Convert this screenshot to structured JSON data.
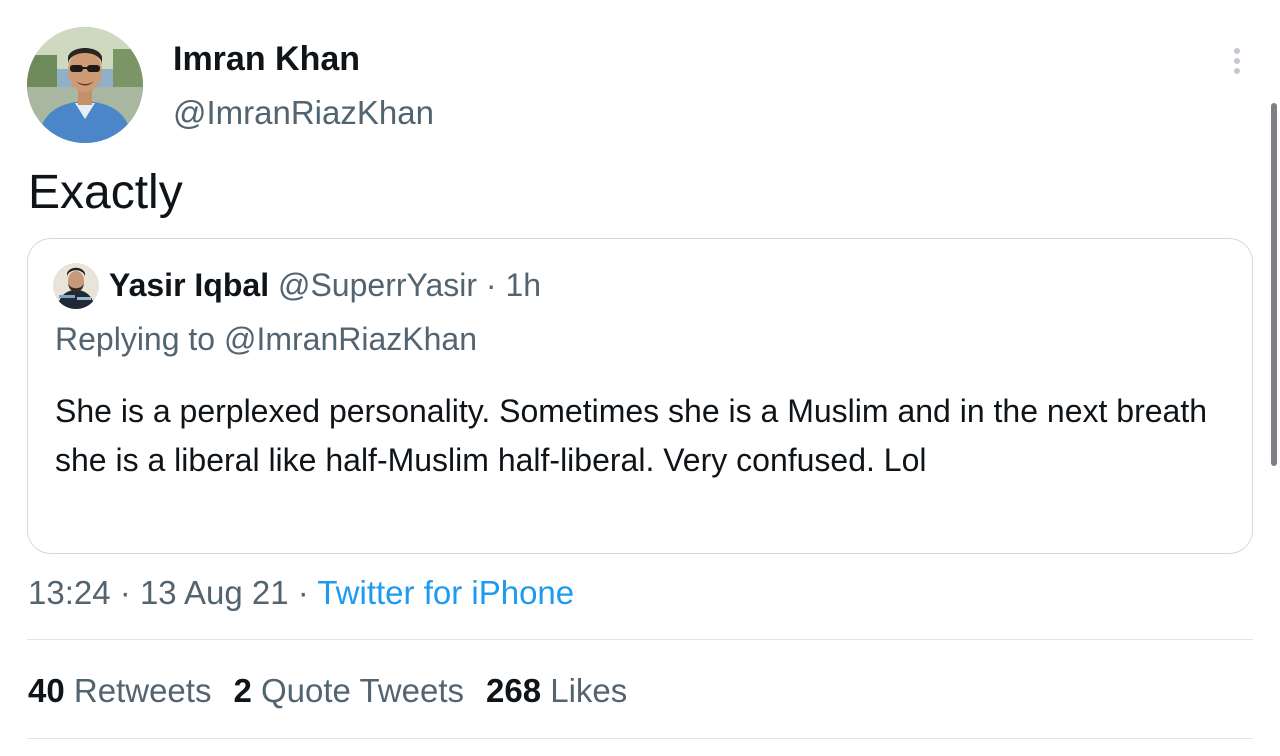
{
  "tweet": {
    "author": {
      "name": "Imran Khan",
      "handle": "@ImranRiazKhan"
    },
    "text": "Exactly",
    "quoted": {
      "name": "Yasir Iqbal",
      "handle": "@SuperrYasir",
      "separator": "·",
      "time": "1h",
      "replying_to": "Replying to @ImranRiazKhan",
      "body": "She is a perplexed personality. Sometimes she is a Muslim and in the next breath she is a liberal like half-Muslim half-liberal. Very confused. Lol"
    },
    "meta": {
      "time": "13:24",
      "separator": "·",
      "date": "13 Aug 21",
      "source": "Twitter for iPhone"
    },
    "stats": {
      "retweets": {
        "count": "40",
        "label": "Retweets"
      },
      "quote_tweets": {
        "count": "2",
        "label": "Quote Tweets"
      },
      "likes": {
        "count": "268",
        "label": "Likes"
      }
    }
  },
  "icons": {
    "more": "more-options-icon"
  },
  "colors": {
    "text_primary": "#0f1419",
    "text_secondary": "#536471",
    "link": "#1d9bf0",
    "border": "#d4d9de"
  }
}
